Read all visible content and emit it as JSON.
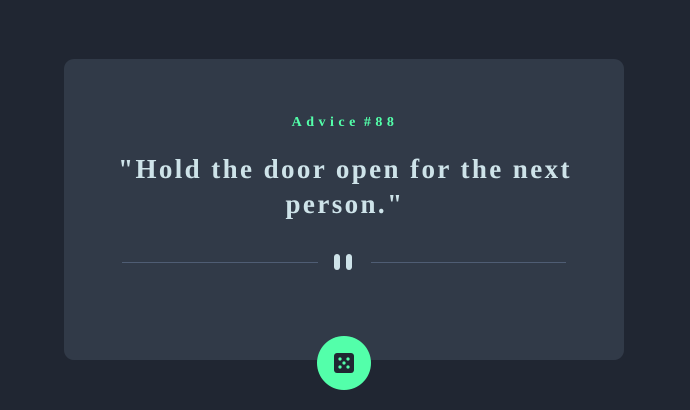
{
  "advice": {
    "label": "Advice",
    "number": "#88",
    "quote": "\"Hold the door open for the next person.\""
  },
  "icons": {
    "divider": "pause-icon",
    "generate_button": "dice-icon"
  },
  "colors": {
    "background": "#202632",
    "card": "#313a48",
    "accent": "#53ffaa",
    "text": "#cee3e9",
    "divider": "#4f5d74"
  }
}
